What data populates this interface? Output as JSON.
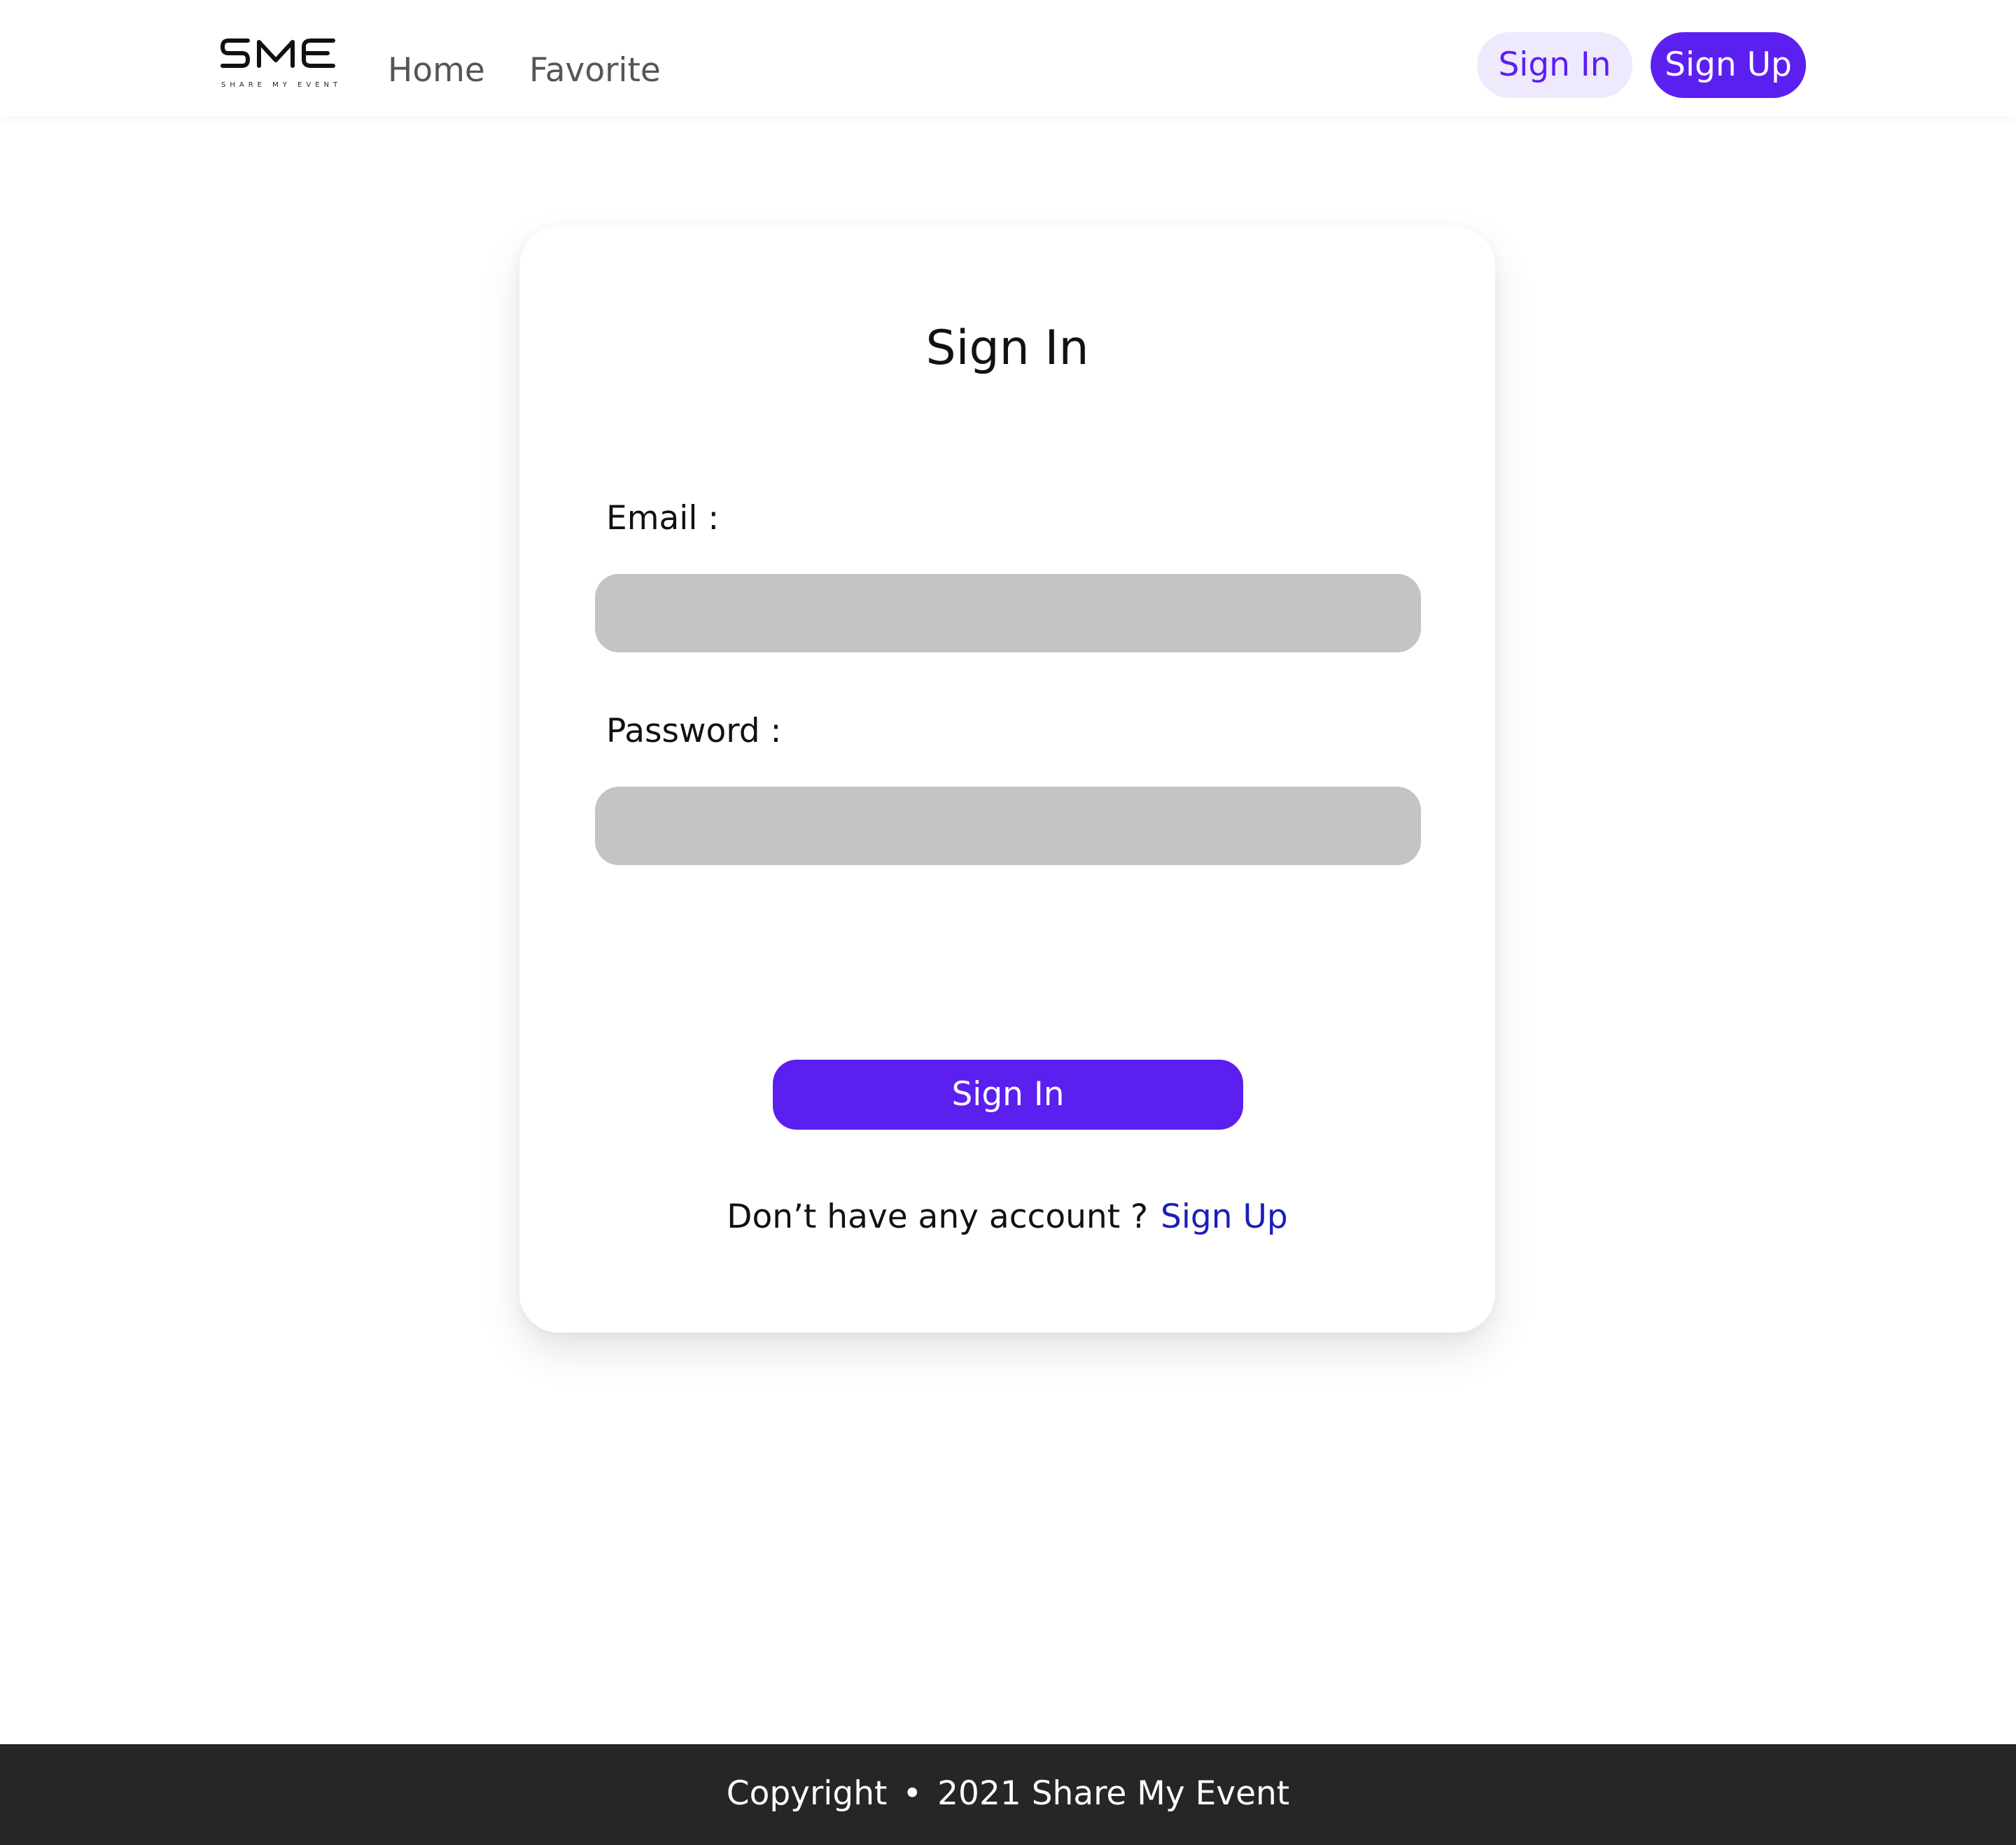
{
  "colors": {
    "accent": "#5b1ff0",
    "accent_light": "#eee9fd",
    "link": "#1a1fb8",
    "input_bg": "#c4c4c4",
    "footer_bg": "#262626"
  },
  "navbar": {
    "logo": {
      "mark": "SME",
      "tagline": "SHARE MY EVENT"
    },
    "links": {
      "home": "Home",
      "favorite": "Favorite"
    },
    "signin_label": "Sign In",
    "signup_label": "Sign Up"
  },
  "form": {
    "title": "Sign In",
    "email_label": "Email :",
    "email_value": "",
    "password_label": "Password :",
    "password_value": "",
    "submit_label": "Sign In",
    "signup_prompt": "Don’t have any account ?",
    "signup_link": "Sign Up"
  },
  "footer": {
    "copyright": "Copyright",
    "separator": "•",
    "year_owner": "2021 Share My Event"
  }
}
